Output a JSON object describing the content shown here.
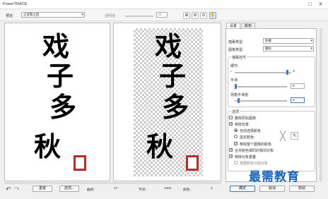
{
  "window": {
    "title": "PowerTRACE"
  },
  "toolbar": {
    "preview_label": "预览:",
    "preview_value": "之前和之后",
    "transparency_label": "透明度:",
    "transparency_value": "80"
  },
  "zoom_icons": [
    "zoom-in-icon",
    "zoom-out-icon",
    "zoom-fit-icon",
    "pan-hand-icon"
  ],
  "artwork": {
    "text": "戏子多秋",
    "seal_color": "#c0282a"
  },
  "tabs": {
    "settings": "设置",
    "colors": "颜色"
  },
  "settings": {
    "trace_type_label": "描摹类型:",
    "trace_type_value": "轮廓",
    "image_type_label": "图像类型:",
    "image_type_value": "徽标",
    "trace_controls_label": "描摹控件",
    "detail_label": "细节:",
    "detail_level": 0.95,
    "smoothing_label": "平滑:",
    "smoothing_value": "0",
    "corner_label": "拐角平滑度:",
    "corner_value": "3",
    "options_label": "选项",
    "opt_delete_original": "删除原始图像",
    "opt_remove_background": "移除背景",
    "opt_auto_bg": "自动选择颜色",
    "opt_specify_color": "指定颜色:",
    "opt_remove_whole": "移除整个图像的颜色",
    "opt_merge_adjacent": "合并颜色相同的相邻对象",
    "opt_remove_overlap": "移除对象重叠",
    "opt_group_by_color": "根据颜色分组对象"
  },
  "bottom": {
    "reset_label": "重置",
    "options_label": "选项...",
    "curves_label": "曲线:",
    "curves_value": "27",
    "nodes_label": "节点:",
    "nodes_value": "2402",
    "colors_label": "颜色:",
    "colors_value": "3"
  },
  "actions": {
    "ok": "确定",
    "cancel": "取消",
    "help": "帮助"
  },
  "watermark": "最需教育",
  "accent": "#3a7bd5"
}
